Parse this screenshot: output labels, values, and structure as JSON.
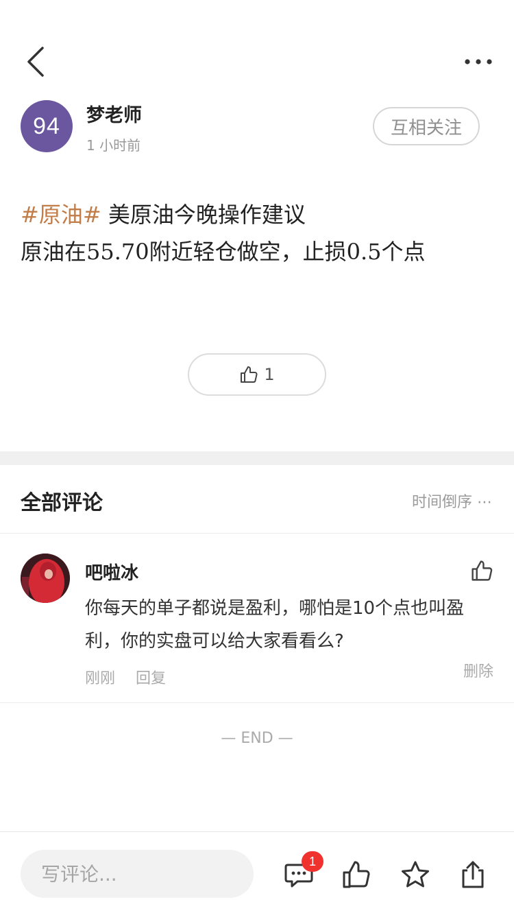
{
  "author": {
    "avatar_text": "94",
    "avatar_color": "#6a57a0",
    "name": "梦老师",
    "time": "1 小时前",
    "follow_label": "互相关注"
  },
  "post": {
    "topic": "#原油#",
    "title": "美原油今晚操作建议",
    "body_parts": [
      "原油在",
      "55.70",
      "附近轻仓做空，止损",
      "0.5",
      "个点"
    ]
  },
  "post_like": {
    "icon": "thumbs-up-icon",
    "count": "1"
  },
  "comments_section": {
    "title": "全部评论",
    "sort_label": "时间倒序",
    "sort_icon": "ellipsis-icon"
  },
  "comments": [
    {
      "name": "吧啦冰",
      "text": "你每天的单子都说是盈利，哪怕是10个点也叫盈利，你的实盘可以给大家看看么?",
      "time": "刚刚",
      "reply_label": "回复",
      "delete_label": "删除"
    }
  ],
  "end_label": "— END —",
  "bottom_bar": {
    "input_placeholder": "写评论...",
    "comment_badge": "1",
    "icons": [
      "comment-icon",
      "thumbs-up-icon",
      "star-icon",
      "share-icon"
    ]
  },
  "colors": {
    "topic": "#c27c47",
    "badge": "#f0322f",
    "divider": "#f0f0f0"
  }
}
